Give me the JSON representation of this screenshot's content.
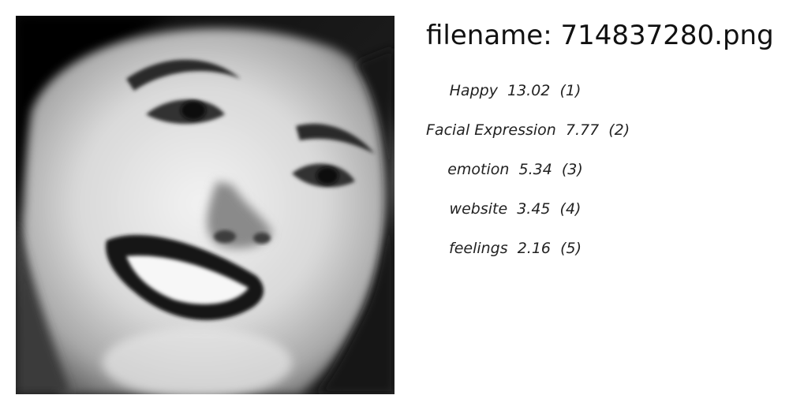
{
  "filename": {
    "label": "filename:",
    "value": "714837280.png"
  },
  "image": {
    "alt": "grayscale close-up photo of a laughing woman's face"
  },
  "tags": [
    {
      "label": "Happy",
      "score": "13.02",
      "rank": "(1)"
    },
    {
      "label": "Facial Expression",
      "score": "7.77",
      "rank": "(2)"
    },
    {
      "label": "emotion",
      "score": "5.34",
      "rank": "(3)"
    },
    {
      "label": "website",
      "score": "3.45",
      "rank": "(4)"
    },
    {
      "label": "feelings",
      "score": "2.16",
      "rank": "(5)"
    }
  ]
}
